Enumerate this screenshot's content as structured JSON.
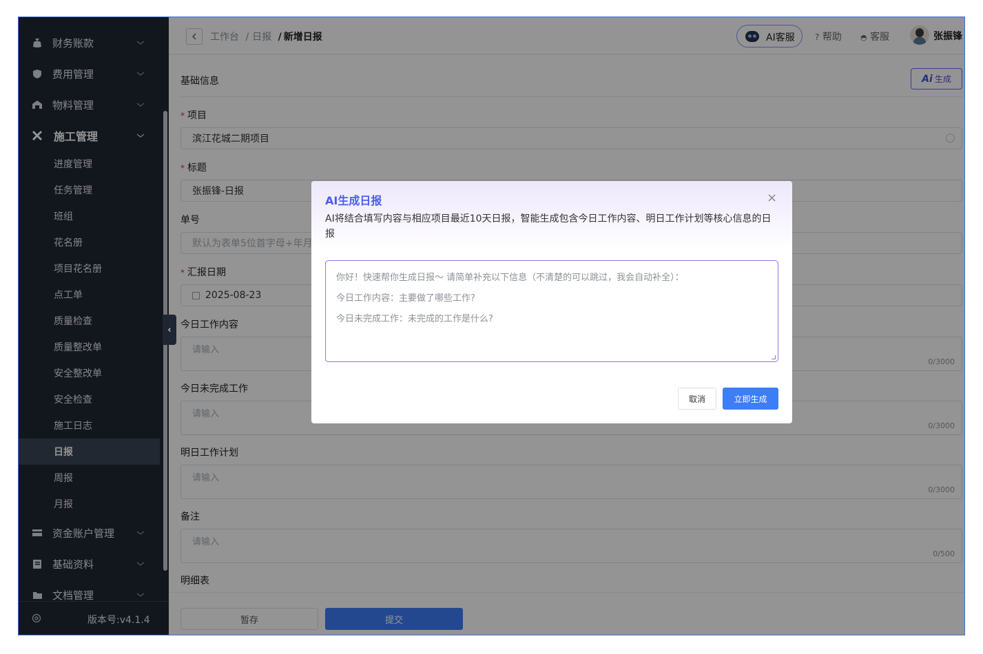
{
  "sidebar": {
    "groups_top": [
      {
        "label": "财务账款",
        "icon": "money-bag-icon"
      },
      {
        "label": "费用管理",
        "icon": "shield-yen-icon"
      },
      {
        "label": "物料管理",
        "icon": "warehouse-icon"
      }
    ],
    "open_group": {
      "label": "施工管理",
      "icon": "tools-icon"
    },
    "sub_items": [
      "进度管理",
      "任务管理",
      "班组",
      "花名册",
      "项目花名册",
      "点工单",
      "质量检查",
      "质量整改单",
      "安全整改单",
      "安全检查",
      "施工日志",
      "日报",
      "周报",
      "月报"
    ],
    "active_sub": "日报",
    "groups_bottom": [
      {
        "label": "资金账户管理",
        "icon": "card-icon"
      },
      {
        "label": "基础资料",
        "icon": "book-icon"
      },
      {
        "label": "文档管理",
        "icon": "folder-icon"
      }
    ],
    "version": "版本号:v4.1.4"
  },
  "header": {
    "breadcrumb": [
      "工作台",
      "日报",
      "新增日报"
    ],
    "ai_service": "AI客服",
    "help": "帮助",
    "service": "客服",
    "user": "张振锋"
  },
  "form": {
    "section_title": "基础信息",
    "ai_generate": {
      "badge": "Ai",
      "label": "生成"
    },
    "project": {
      "label": "项目",
      "value": "滨江花城二期项目"
    },
    "title": {
      "label": "标题",
      "value": "张振锋-日报"
    },
    "number": {
      "label": "单号",
      "placeholder": "默认为表单5位首字母+年月"
    },
    "date": {
      "label": "汇报日期",
      "value": "2025-08-23"
    },
    "today_work": {
      "label": "今日工作内容",
      "placeholder": "请输入",
      "count": "0/3000"
    },
    "unfinished": {
      "label": "今日未完成工作",
      "placeholder": "请输入",
      "count": "0/3000"
    },
    "tomorrow": {
      "label": "明日工作计划",
      "placeholder": "请输入",
      "count": "0/3000"
    },
    "remark": {
      "label": "备注",
      "placeholder": "请输入",
      "count": "0/500"
    },
    "detail_table": {
      "label": "明细表"
    }
  },
  "footer": {
    "save": "暂存",
    "submit": "提交"
  },
  "modal": {
    "title": "AI生成日报",
    "description": "AI将结合填写内容与相应项目最近10天日报，智能生成包含今日工作内容、明日工作计划等核心信息的日报",
    "prompt_lines": [
      "你好！快速帮你生成日报～ 请简单补充以下信息（不清楚的可以跳过，我会自动补全）：",
      "今日工作内容：主要做了哪些工作?",
      "今日未完成工作：未完成的工作是什么?"
    ],
    "cancel": "取消",
    "generate": "立即生成"
  },
  "colors": {
    "sidebar_bg": "#1f2633",
    "primary": "#3d7df6",
    "ai_purple": "#7a5cf0",
    "required": "#f5222d"
  }
}
